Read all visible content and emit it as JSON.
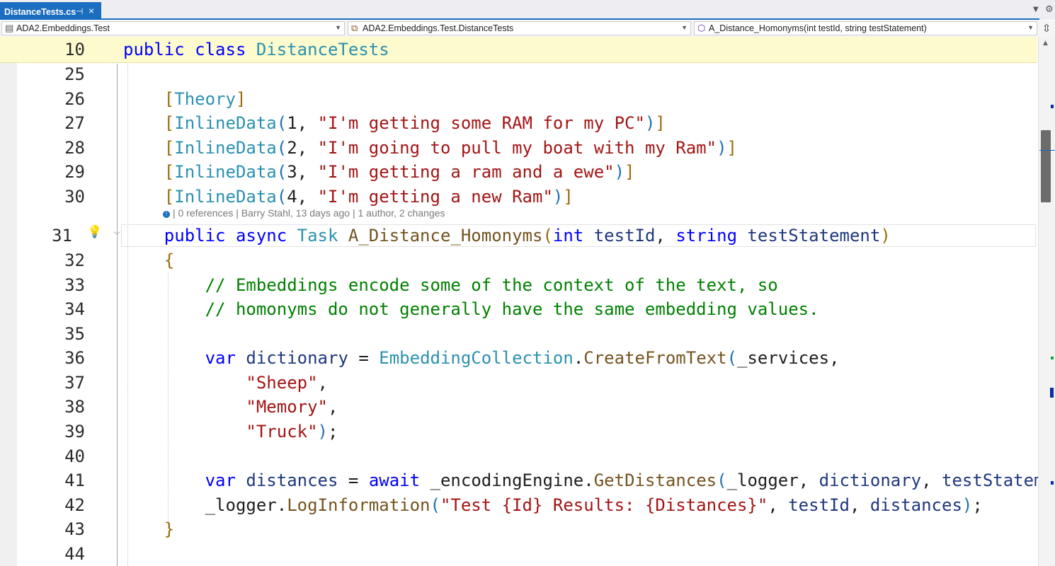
{
  "tabs": [
    {
      "label": "DistanceTests.cs",
      "pin_glyph": "⊣",
      "close_glyph": "×"
    }
  ],
  "navbar": {
    "project": "ADA2.Embeddings.Test",
    "class": "ADA2.Embeddings.Test.DistanceTests",
    "member": "A_Distance_Homonyms(int testId, string testStatement)"
  },
  "sticky": {
    "number": "10",
    "keyword1": "public",
    "keyword2": "class",
    "name": "DistanceTests"
  },
  "codelens": {
    "text": "| 0 references | Barry Stahl, 13 days ago | 1 author, 2 changes"
  },
  "lines": [
    {
      "n": "25"
    },
    {
      "n": "26",
      "t1": "Theory"
    },
    {
      "n": "27",
      "t1": "InlineData",
      "num": "1",
      "str": "\"I'm getting some RAM for my PC\""
    },
    {
      "n": "28",
      "t1": "InlineData",
      "num": "2",
      "str": "\"I'm going to pull my boat with my Ram\""
    },
    {
      "n": "29",
      "t1": "InlineData",
      "num": "3",
      "str": "\"I'm getting a ram and a ewe\""
    },
    {
      "n": "30",
      "t1": "InlineData",
      "num": "4",
      "str": "\"I'm getting a new Ram\""
    },
    {
      "n": "31",
      "kw1": "public",
      "kw2": "async",
      "ty": "Task",
      "name": "A_Distance_Homonyms",
      "kw3": "int",
      "p1": "testId",
      "kw4": "string",
      "p2": "testStatement"
    },
    {
      "n": "32",
      "brace": "{"
    },
    {
      "n": "33",
      "comment": "// Embeddings encode some of the context of the text, so"
    },
    {
      "n": "34",
      "comment": "// homonyms do not generally have the same embedding values."
    },
    {
      "n": "35"
    },
    {
      "n": "36",
      "kw": "var",
      "v": "dictionary",
      "op": " = ",
      "ty": "EmbeddingCollection",
      "dot": ".",
      "me": "CreateFromText",
      "arg": "_services",
      "tail": ","
    },
    {
      "n": "37",
      "str": "\"Sheep\"",
      "tail": ","
    },
    {
      "n": "38",
      "str": "\"Memory\"",
      "tail": ","
    },
    {
      "n": "39",
      "str": "\"Truck\"",
      "tail": ";"
    },
    {
      "n": "40"
    },
    {
      "n": "41",
      "kw": "var",
      "v": "distances",
      "op": " = ",
      "kw2": "await",
      "obj": "_encodingEngine",
      "dot": ".",
      "me": "GetDistances",
      "a1": "_logger",
      "a2": "dictionary",
      "a3": "testStatemen"
    },
    {
      "n": "42",
      "obj": "_logger",
      "dot": ".",
      "me": "LogInformation",
      "str": "\"Test {Id} Results: {Distances}\"",
      "a1": "testId",
      "a2": "distances"
    },
    {
      "n": "43",
      "brace": "}"
    },
    {
      "n": "44"
    }
  ],
  "colors": {
    "keyword": "#0000ff",
    "type": "#2b91af",
    "string": "#a31515",
    "comment": "#008000",
    "accent": "#1a6dbf"
  },
  "icons": [
    "csharp-file-icon",
    "pin-icon",
    "close-icon",
    "project-icon",
    "class-icon",
    "method-icon",
    "lightbulb-icon",
    "collapse-chevron-icon",
    "split-editor-icon",
    "settings-icon"
  ]
}
